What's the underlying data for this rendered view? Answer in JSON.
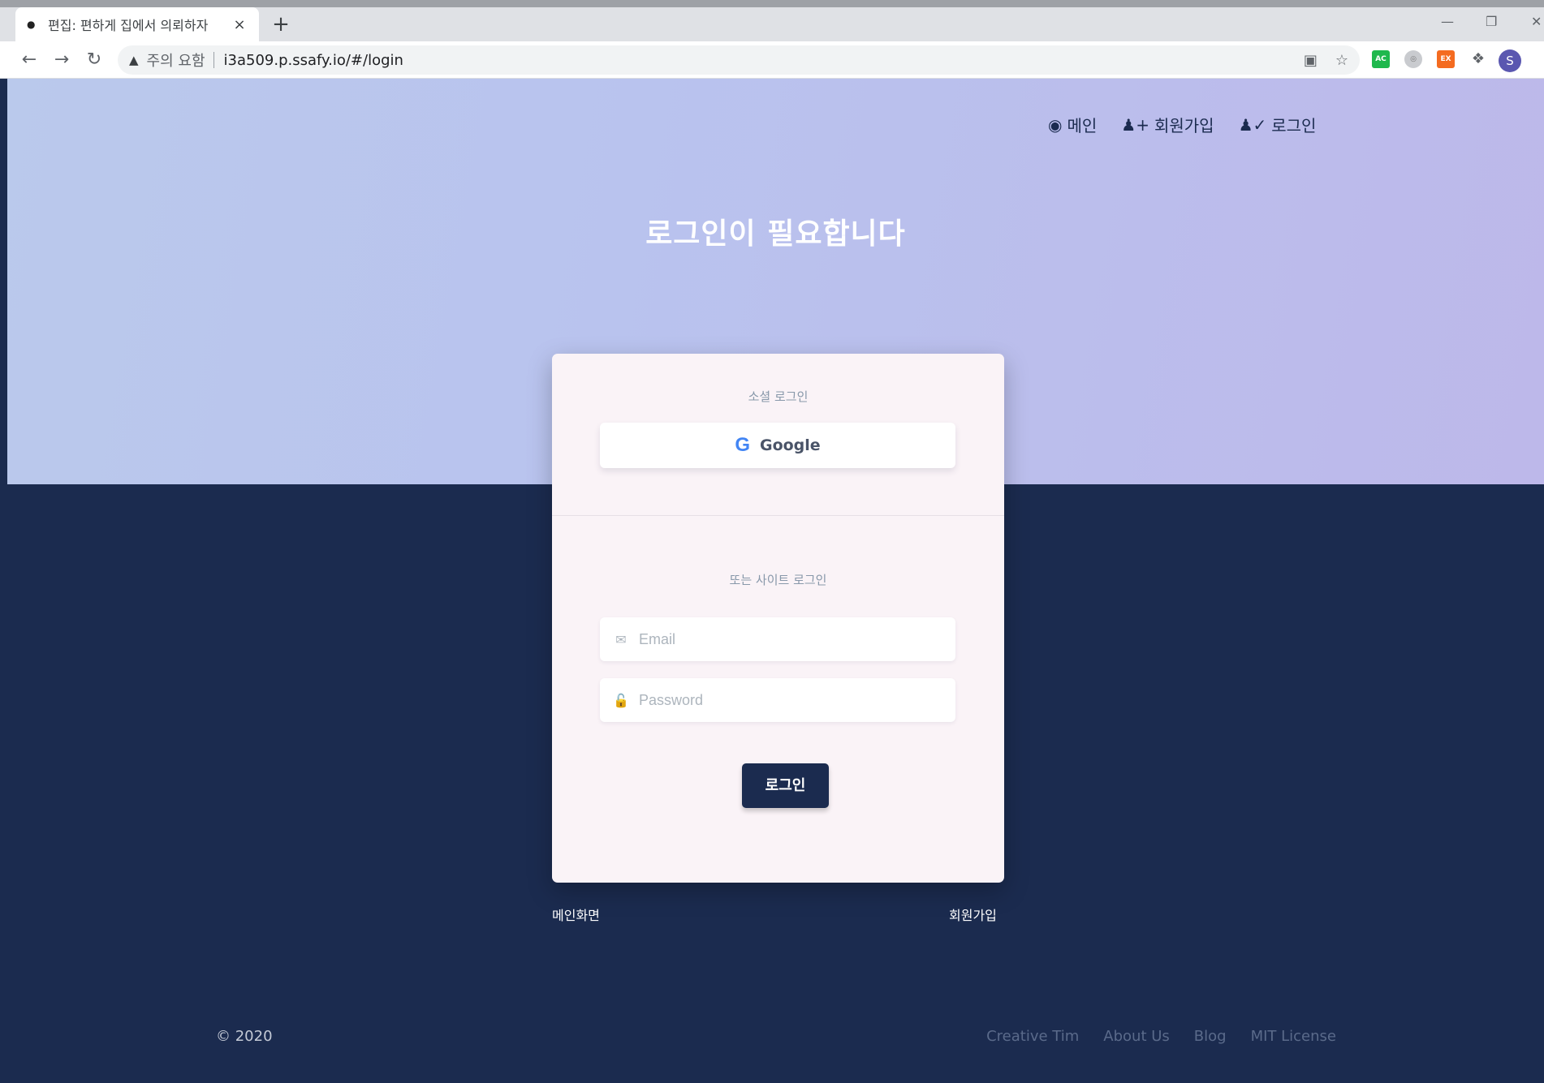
{
  "browser": {
    "tab_title": "편집: 편하게 집에서 의뢰하자",
    "tab_close": "×",
    "new_tab": "+",
    "security_warning": "주의 요함",
    "url": "i3a509.p.ssafy.io/#/login",
    "profile_initial": "S",
    "extensions": [
      "AC",
      "EX"
    ]
  },
  "nav": {
    "main_label": "메인",
    "signup_label": "회원가입",
    "login_label": "로그인"
  },
  "hero": {
    "title": "로그인이 필요합니다"
  },
  "card": {
    "social_label": "소셜 로그인",
    "google_label": "Google",
    "site_label": "또는 사이트 로그인",
    "email_placeholder": "Email",
    "password_placeholder": "Password",
    "login_button": "로그인"
  },
  "links": {
    "main_screen": "메인화면",
    "signup": "회원가입"
  },
  "footer": {
    "copyright": "© 2020",
    "links": [
      "Creative Tim",
      "About Us",
      "Blog",
      "MIT License"
    ]
  },
  "colors": {
    "navy": "#1b2b4f",
    "hero_gradient_start": "#bac9ec",
    "hero_gradient_end": "#bdb8ea",
    "card_bg": "#faf3f7"
  }
}
